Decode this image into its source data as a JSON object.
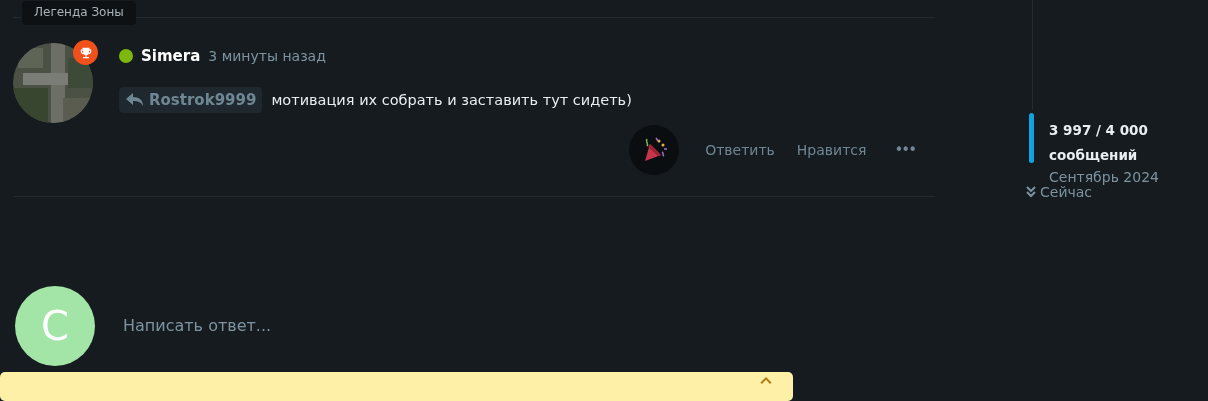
{
  "tooltip": {
    "text": "Легенда Зоны"
  },
  "post": {
    "online": true,
    "author": "Simera",
    "time": "3 минуты назад",
    "quote_author": "Rostrok9999",
    "text": "мотивация их собрать и заставить тут сидеть)",
    "actions": [
      "Ответить",
      "Нравится"
    ],
    "more": "•••"
  },
  "timeline": {
    "count": "3 997 / 4 000",
    "unit": "сообщений",
    "date": "Сентябрь 2024",
    "now": "Сейчас"
  },
  "reply": {
    "avatar_letter": "C",
    "placeholder": "Написать ответ..."
  }
}
